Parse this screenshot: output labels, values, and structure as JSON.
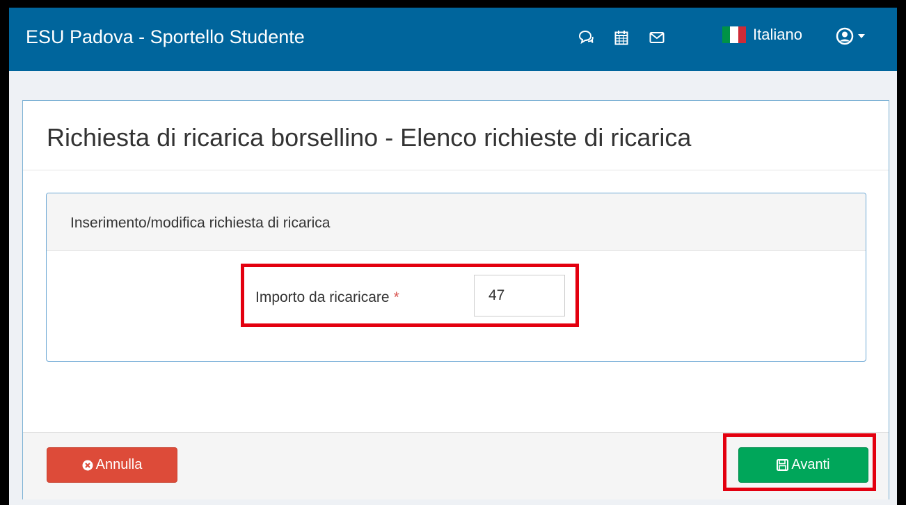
{
  "navbar": {
    "brand": "ESU Padova - Sportello Studente",
    "icons": [
      "chat-icon",
      "calendar-icon",
      "envelope-icon"
    ],
    "language": "Italiano",
    "user_icon": "user-circle-icon"
  },
  "page": {
    "title": "Richiesta di ricarica borsellino - Elenco richieste di ricarica"
  },
  "panel": {
    "title": "Inserimento/modifica richiesta di ricarica",
    "field_label": "Importo da ricaricare",
    "required_mark": "*",
    "amount_value": "47"
  },
  "footer": {
    "cancel_label": "Annulla",
    "next_label": "Avanti"
  },
  "colors": {
    "navbar": "#00659c",
    "cancel": "#dd4b39",
    "next": "#00a65a",
    "highlight": "#e3000f"
  }
}
